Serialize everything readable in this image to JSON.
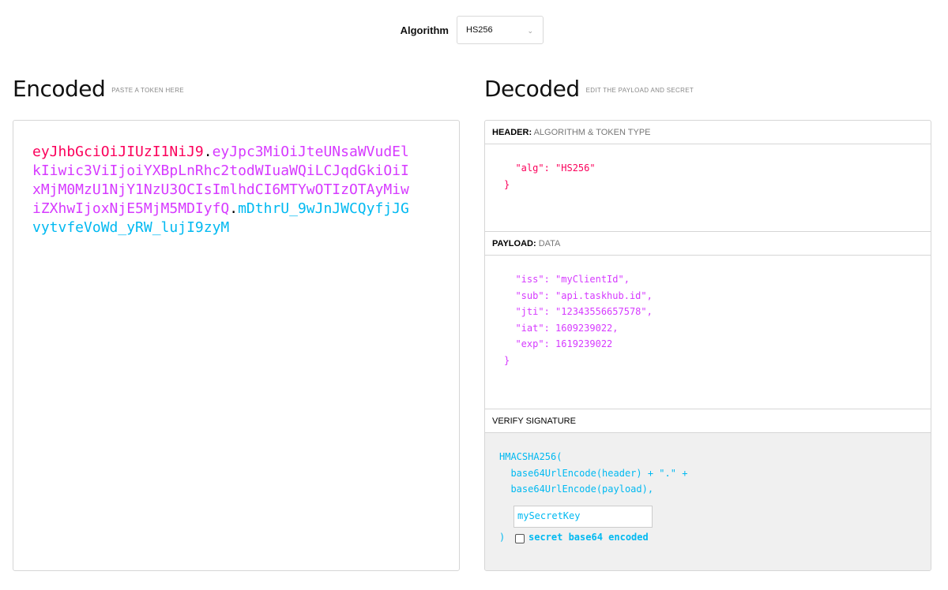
{
  "algorithm": {
    "label": "Algorithm",
    "value": "HS256"
  },
  "encoded": {
    "title": "Encoded",
    "subtitle": "PASTE A TOKEN HERE",
    "token_header": "eyJhbGciOiJIUzI1NiJ9",
    "token_payload": "eyJpc3MiOiJteUNsaWVudElkIiwic3ViIjoiYXBpLnRhc2todWIuaWQiLCJqdGkiOiIxMjM0MzU1NjY1NzU3OCIsImlhdCI6MTYwOTIzOTAyMiwiZXhwIjoxNjE5MjM5MDIyfQ",
    "token_signature": "mDthrU_9wJnJWCQyfjJGvytvfeVoWd_yRW_lujI9zyM",
    "dot": "."
  },
  "decoded": {
    "title": "Decoded",
    "subtitle": "EDIT THE PAYLOAD AND SECRET",
    "header_section": {
      "label": "HEADER:",
      "sublabel": "ALGORITHM & TOKEN TYPE",
      "code": "  \"alg\": \"HS256\"\n}"
    },
    "payload_section": {
      "label": "PAYLOAD:",
      "sublabel": "DATA",
      "code": "  \"iss\": \"myClientId\",\n  \"sub\": \"api.taskhub.id\",\n  \"jti\": \"12343556657578\",\n  \"iat\": 1609239022,\n  \"exp\": 1619239022\n}"
    },
    "verify_section": {
      "label": "VERIFY SIGNATURE",
      "code": "HMACSHA256(\n  base64UrlEncode(header) + \".\" +\n  base64UrlEncode(payload),",
      "secret": "mySecretKey",
      "close": ")",
      "checkbox_label": "secret base64 encoded"
    }
  },
  "colors": {
    "header": "#fb015b",
    "payload": "#d63aff",
    "signature": "#00b9f1"
  }
}
